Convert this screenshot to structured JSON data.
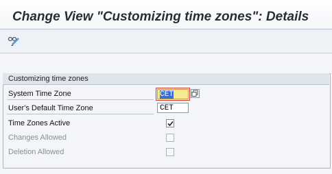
{
  "window": {
    "title": "Change View \"Customizing time zones\": Details"
  },
  "toolbar": {
    "icons": [
      "display-change-icon"
    ]
  },
  "group": {
    "title": "Customizing time zones",
    "fields": [
      {
        "label": "System Time Zone",
        "value": "CET",
        "focused": true,
        "has_f4_help": true
      },
      {
        "label": "User's Default Time Zone",
        "value": "CET",
        "focused": false
      }
    ],
    "checkboxes": [
      {
        "label": "Time Zones Active",
        "checked": true,
        "enabled": true
      },
      {
        "label": "Changes Allowed",
        "checked": false,
        "enabled": false
      },
      {
        "label": "Deletion Allowed",
        "checked": false,
        "enabled": false
      }
    ]
  },
  "colors": {
    "focus_field_bg": "#f7e98f",
    "focus_outline": "#d63b3b",
    "selection": "#3a6fd0"
  }
}
